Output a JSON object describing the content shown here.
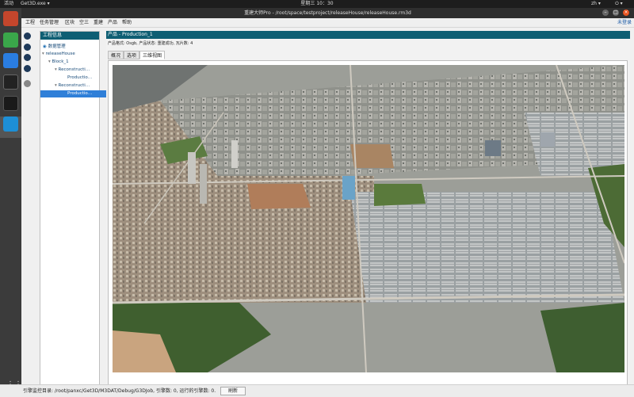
{
  "topbar": {
    "activities": "活动",
    "app_menu": "Get3D.exe ▾",
    "clock": "星期三 10：30",
    "lang": "zh ▾",
    "power": "⏻ ▾"
  },
  "window": {
    "title": "重建大师Pro - /root/space/testproject/releaseHouse/releaseHouse.rm3d"
  },
  "menu": {
    "items": [
      "工程",
      "任务管理",
      "区块",
      "空三",
      "重建",
      "产品",
      "帮助"
    ],
    "login": "未登录"
  },
  "tree": {
    "header": "工程信息",
    "nodes": [
      {
        "label": "数据管理",
        "arrow": "",
        "indent": 0,
        "selected": false
      },
      {
        "label": "releaseHouse",
        "arrow": "▾",
        "indent": 0,
        "selected": false
      },
      {
        "label": "Block_1",
        "arrow": "▾",
        "indent": 1,
        "selected": false
      },
      {
        "label": "Reconstructi…",
        "arrow": "▾",
        "indent": 2,
        "selected": false
      },
      {
        "label": "Productio…",
        "arrow": "",
        "indent": 3,
        "selected": false
      },
      {
        "label": "Reconstructi…",
        "arrow": "▾",
        "indent": 2,
        "selected": false
      },
      {
        "label": "Productio…",
        "arrow": "",
        "indent": 3,
        "selected": true
      }
    ]
  },
  "product": {
    "header": "产品 - Production_1",
    "info": "产品格式: Osgb, 产品状态: 重建成功, 瓦片数: 4",
    "tabs": [
      {
        "label": "概况",
        "active": false
      },
      {
        "label": "选项",
        "active": false
      },
      {
        "label": "三维视图",
        "active": true
      }
    ]
  },
  "status": {
    "text": "引擎监控目录: /root/panxc/Get3D/M3DAT/Debug/G3DJob, 引擎数: 0, 运行的引擎数: 0.",
    "refresh": "刷新"
  }
}
